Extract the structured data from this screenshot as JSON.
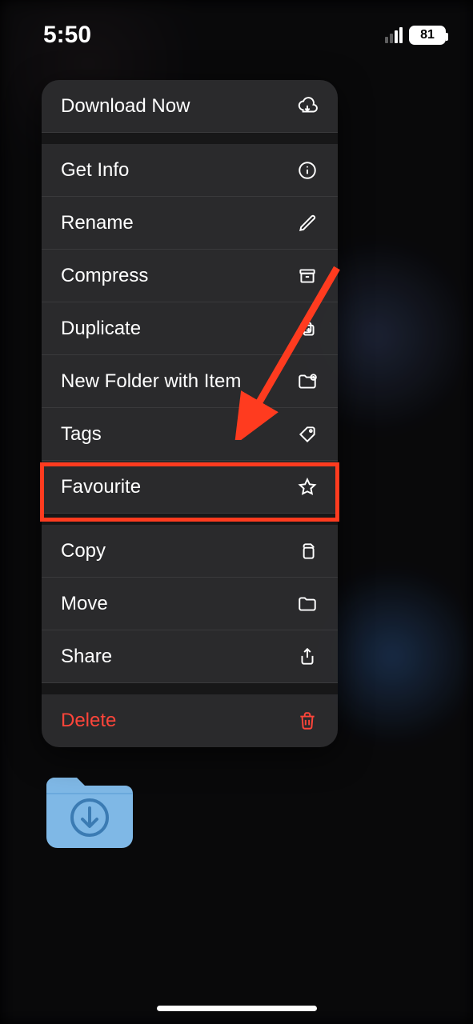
{
  "status": {
    "time": "5:50",
    "battery_percent": "81"
  },
  "menu": {
    "items": [
      {
        "label": "Download Now",
        "icon": "cloud-download-icon",
        "danger": false
      },
      {
        "label": "Get Info",
        "icon": "info-icon",
        "danger": false
      },
      {
        "label": "Rename",
        "icon": "pencil-icon",
        "danger": false
      },
      {
        "label": "Compress",
        "icon": "archive-icon",
        "danger": false
      },
      {
        "label": "Duplicate",
        "icon": "duplicate-icon",
        "danger": false
      },
      {
        "label": "New Folder with Item",
        "icon": "folder-plus-icon",
        "danger": false
      },
      {
        "label": "Tags",
        "icon": "tag-icon",
        "danger": false
      },
      {
        "label": "Favourite",
        "icon": "star-icon",
        "danger": false
      },
      {
        "label": "Copy",
        "icon": "copy-icon",
        "danger": false
      },
      {
        "label": "Move",
        "icon": "folder-icon",
        "danger": false
      },
      {
        "label": "Share",
        "icon": "share-icon",
        "danger": false
      },
      {
        "label": "Delete",
        "icon": "trash-icon",
        "danger": true
      }
    ]
  },
  "annotation": {
    "highlighted_item_label": "Favourite",
    "highlight_color": "#ff3b1f",
    "arrow_color": "#ff3b1f"
  }
}
